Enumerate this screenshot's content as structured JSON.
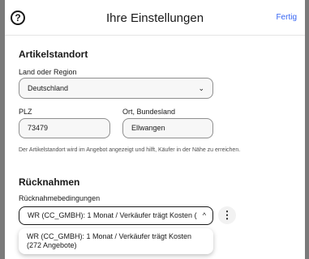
{
  "header": {
    "title": "Ihre Einstellungen",
    "done_label": "Fertig",
    "help_icon": "?"
  },
  "location": {
    "section_title": "Artikelstandort",
    "country_label": "Land oder Region",
    "country_value": "Deutschland",
    "zip_label": "PLZ",
    "zip_value": "73479",
    "city_label": "Ort, Bundesland",
    "city_value": "Ellwangen",
    "hint": "Der Artikelstandort wird im Angebot angezeigt und hilft, Käufer in der Nähe zu erreichen."
  },
  "returns": {
    "section_title": "Rücknahmen",
    "policy_label": "Rücknahmebedingungen",
    "policy_value": "WR (CC_GMBH): 1 Monat / Verkäufer trägt Kosten (",
    "more_icon": "⋮",
    "options": [
      {
        "line1": "WR (CC_GMBH): 1 Monat / Verkäufer trägt Kosten",
        "line2": "(272 Angebote)"
      }
    ]
  },
  "icons": {
    "chevron_down": "⌄",
    "chevron_up": "^"
  }
}
